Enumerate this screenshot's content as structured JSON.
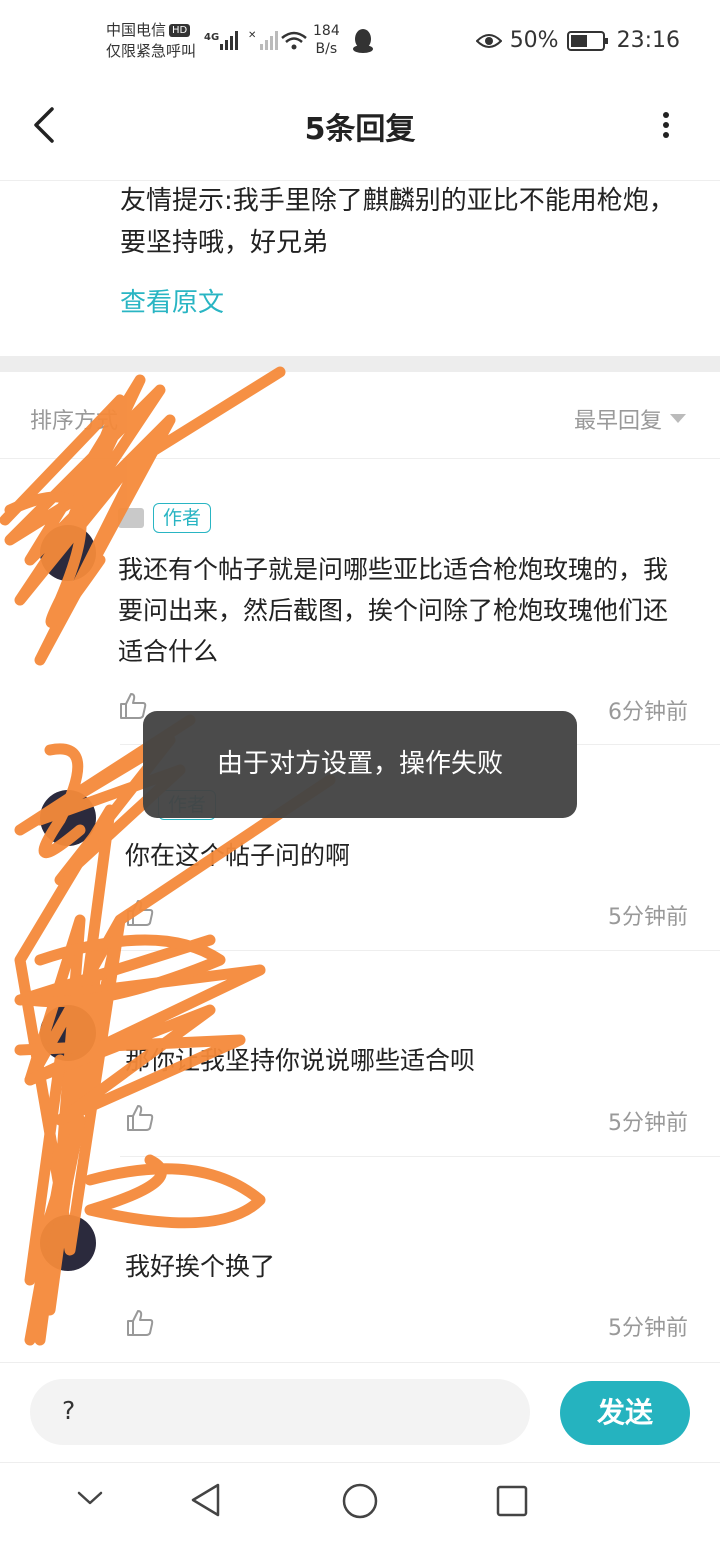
{
  "status_bar": {
    "carrier_line1": "中国电信",
    "hd_badge": "HD",
    "carrier_line2": "仅限紧急呼叫",
    "net_speed_value": "184",
    "net_speed_unit": "B/s",
    "battery": "50%",
    "time": "23:16"
  },
  "header": {
    "title": "5条回复"
  },
  "original_post": {
    "text": "友情提示:我手里除了麒麟别的亚比不能用枪炮，要坚持哦，好兄弟",
    "view_original": "查看原文"
  },
  "sort": {
    "label": "排序方式",
    "value": "最早回复"
  },
  "replies": [
    {
      "tag": "作者",
      "text": "我还有个帖子就是问哪些亚比适合枪炮玫瑰的，我要问出来，然后截图，挨个问除了枪炮玫瑰他们还适合什么",
      "time": "6分钟前"
    },
    {
      "tag": "作者",
      "text": "你在这个帖子问的啊",
      "time": "5分钟前"
    },
    {
      "tag": "",
      "text": "那你让我坚持你说说哪些适合呗",
      "time": "5分钟前"
    },
    {
      "tag": "",
      "text": "我好挨个换了",
      "time": "5分钟前"
    }
  ],
  "toast": {
    "message": "由于对方设置，操作失败"
  },
  "composer": {
    "input_value": "?",
    "send_label": "发送"
  },
  "colors": {
    "accent": "#29b5c3",
    "send_button": "#25b3bf",
    "scribble": "#f58a3a"
  }
}
